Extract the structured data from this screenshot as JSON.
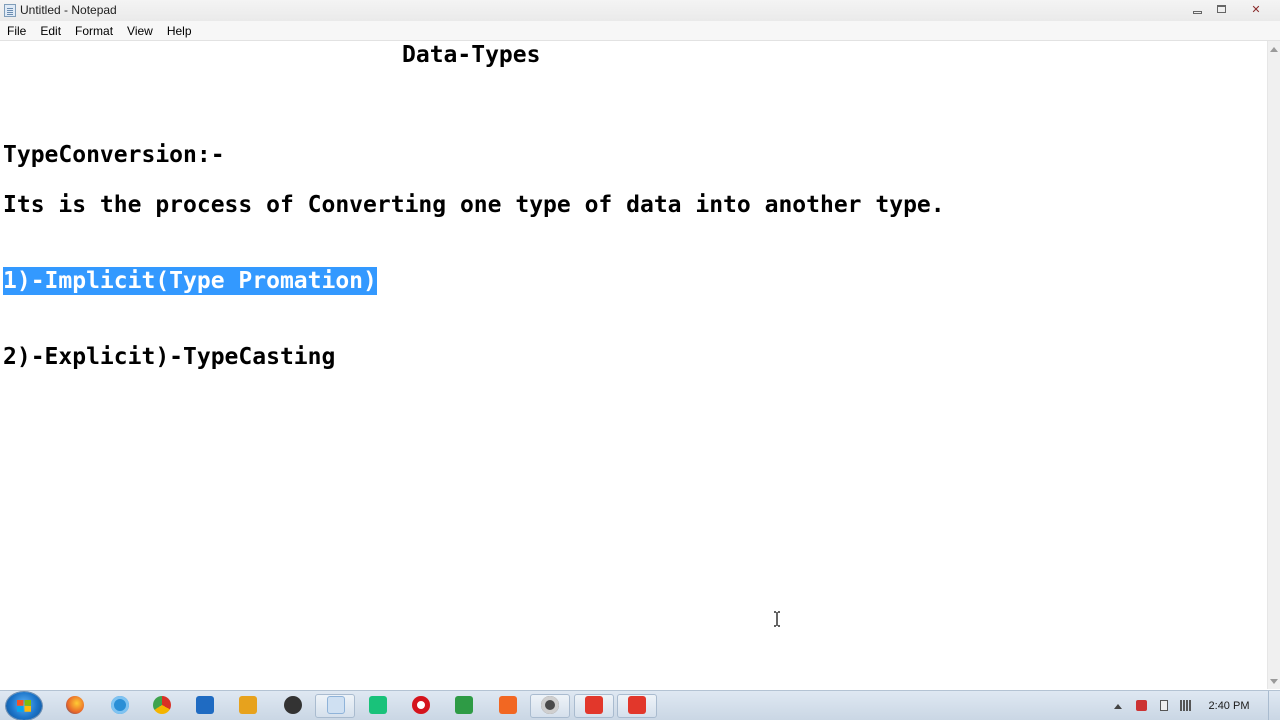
{
  "window": {
    "title": "Untitled - Notepad",
    "minimize_icon": "minimize-icon",
    "maximize_icon": "restore-icon",
    "close_label": "✕"
  },
  "menu": {
    "items": [
      {
        "label": "File"
      },
      {
        "label": "Edit"
      },
      {
        "label": "Format"
      },
      {
        "label": "View"
      },
      {
        "label": "Help"
      }
    ]
  },
  "document": {
    "title": "Data-Types",
    "heading": "TypeConversion:-",
    "description": "Its is the process of Converting one type of data into another type.",
    "item1": "1)-Implicit(Type Promation)",
    "item2": "2)-Explicit)-TypeCasting",
    "selected_text": "1)-Implicit(Type Promation)",
    "selection_color": "#3399ff"
  },
  "taskbar": {
    "apps": [
      {
        "name": "firefox-icon",
        "color": "#e8662a"
      },
      {
        "name": "internet-explorer-icon",
        "color": "#2a8fd6"
      },
      {
        "name": "chrome-icon",
        "color": "#3fa34d"
      },
      {
        "name": "outlook-icon",
        "color": "#1f6bc2"
      },
      {
        "name": "media-player-icon",
        "color": "#e7a21d"
      },
      {
        "name": "media-app-icon",
        "color": "#333333"
      },
      {
        "name": "notepad-icon",
        "color": "#8fb3d9"
      },
      {
        "name": "app-green-icon",
        "color": "#19c27a"
      },
      {
        "name": "opera-icon",
        "color": "#d4141d"
      },
      {
        "name": "excel-like-icon",
        "color": "#2e9b45"
      },
      {
        "name": "mi-icon",
        "color": "#f26722"
      },
      {
        "name": "settings-icon",
        "color": "#4a4a4a"
      },
      {
        "name": "recorder-icon",
        "color": "#e2372b"
      },
      {
        "name": "recorder-icon-2",
        "color": "#e2372b"
      }
    ],
    "clock": "2:40 PM"
  }
}
